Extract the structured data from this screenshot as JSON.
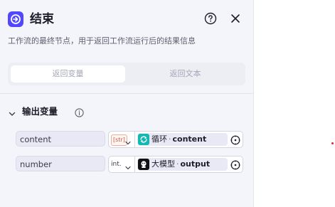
{
  "header": {
    "title": "结束",
    "description": "工作流的最终节点，用于返回工作流运行后的结果信息"
  },
  "tabs": [
    {
      "label": "返回变量",
      "active": true
    },
    {
      "label": "返回文本",
      "active": false
    }
  ],
  "output_section": {
    "title": "输出变量"
  },
  "variables": [
    {
      "name": "content",
      "type": "[str]",
      "source_node": "循环",
      "separator": "·",
      "source_var": "content",
      "source_icon": "loop-icon"
    },
    {
      "name": "number",
      "type": "int.",
      "source_node": "大模型",
      "separator": "·",
      "source_var": "output",
      "source_icon": "llm-icon"
    }
  ],
  "colors": {
    "brand": "#5147ff",
    "loop_icon_bg": "#14b8b2",
    "llm_icon_bg": "#111111",
    "marker": "#e0262c"
  }
}
